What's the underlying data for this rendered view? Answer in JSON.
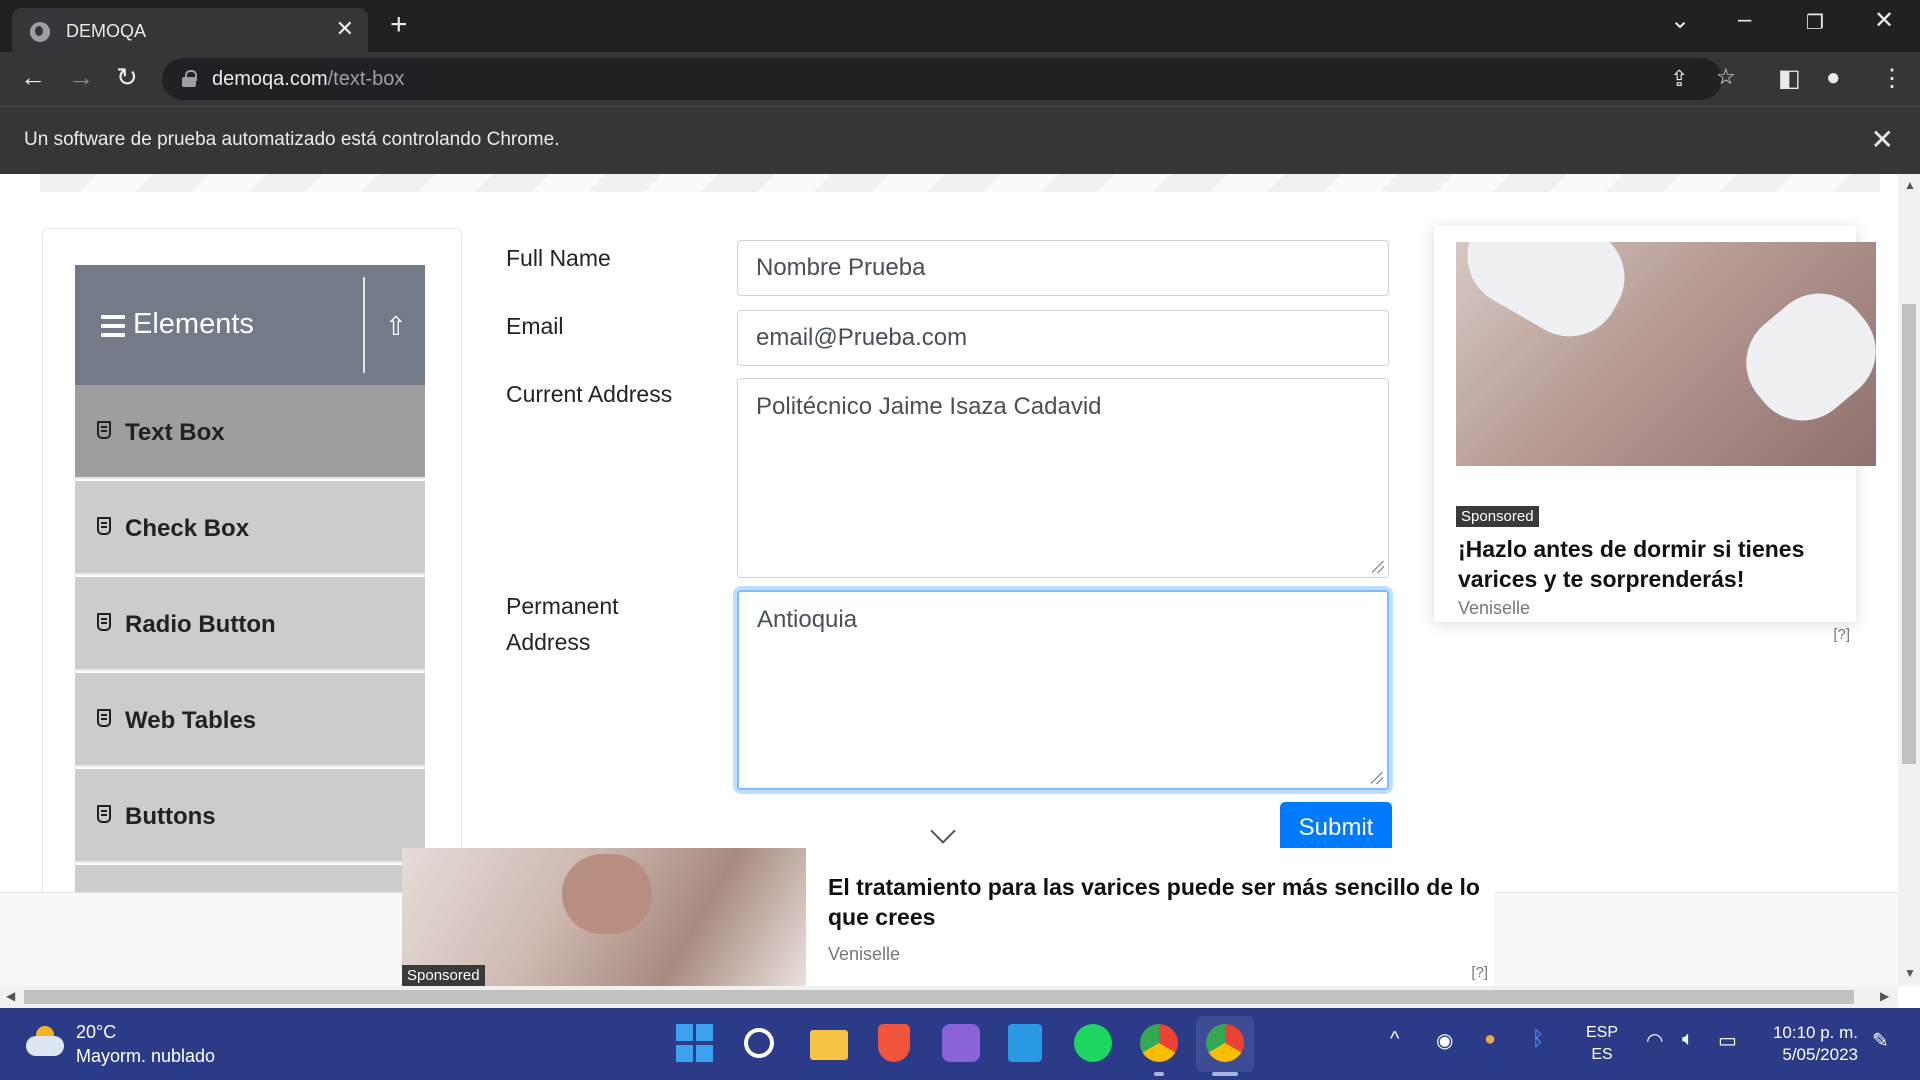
{
  "browser": {
    "tab_title": "DEMOQA",
    "url_host": "demoqa.com",
    "url_path": "/text-box",
    "automation_notice": "Un software de prueba automatizado está controlando Chrome."
  },
  "sidebar": {
    "group_title": "Elements",
    "items": [
      {
        "label": "Text Box",
        "active": true
      },
      {
        "label": "Check Box",
        "active": false
      },
      {
        "label": "Radio Button",
        "active": false
      },
      {
        "label": "Web Tables",
        "active": false
      },
      {
        "label": "Buttons",
        "active": false
      }
    ]
  },
  "form": {
    "full_name_label": "Full Name",
    "full_name_value": "Nombre Prueba",
    "email_label": "Email",
    "email_value": "email@Prueba.com",
    "current_address_label": "Current Address",
    "current_address_value": "Politécnico Jaime Isaza Cadavid",
    "permanent_address_label_1": "Permanent",
    "permanent_address_label_2": "Address",
    "permanent_address_value": "Antioquia",
    "submit_label": "Submit"
  },
  "ads": {
    "right": {
      "sponsored": "Sponsored",
      "headline": "¡Hazlo antes de dormir si tienes varices y te sorprenderás!",
      "brand": "Veniselle",
      "info": "[?]"
    },
    "bottom": {
      "sponsored": "Sponsored",
      "headline": "El tratamiento para las varices puede ser más sencillo de lo que crees",
      "brand": "Veniselle",
      "info": "[?]"
    }
  },
  "taskbar": {
    "temperature": "20°C",
    "weather": "Mayorm. nublado",
    "lang_top": "ESP",
    "lang_bottom": "ES",
    "time": "10:10 p. m.",
    "date": "5/05/2023"
  },
  "colors": {
    "primary": "#007bff",
    "sidebar_header": "#727b87",
    "taskbar": "#2c3b87"
  }
}
